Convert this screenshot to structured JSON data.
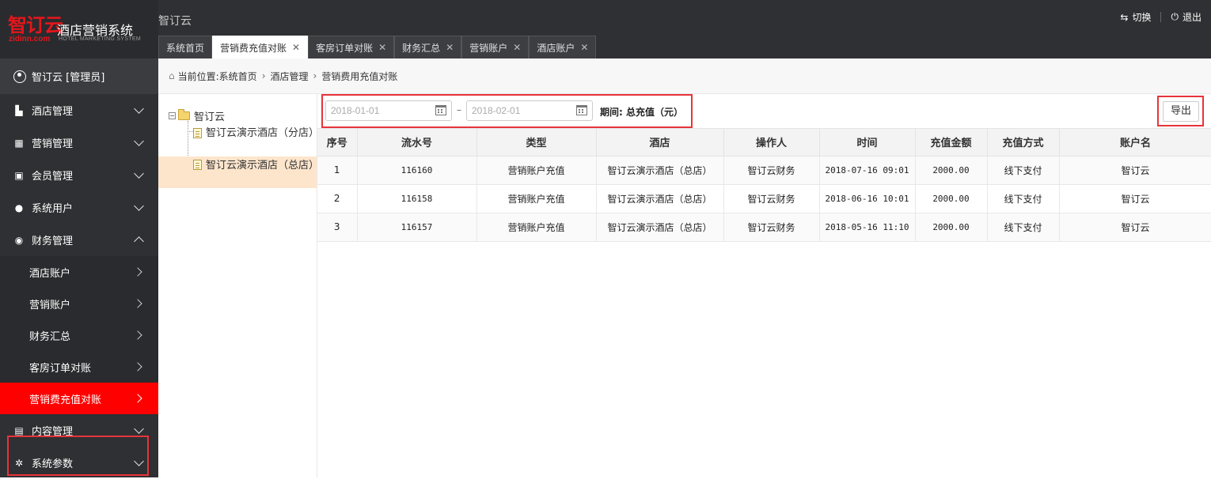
{
  "logo": {
    "mark": "智订云",
    "url": "zidinn.com",
    "name_cn": "酒店营销系统",
    "name_en": "HOTEL MARKETING SYSTEM"
  },
  "app_title": "智订云",
  "top_actions": {
    "switch": "切换",
    "logout": "退出"
  },
  "tabs": [
    {
      "label": "系统首页",
      "closable": false
    },
    {
      "label": "营销费充值对账",
      "closable": true,
      "active": true
    },
    {
      "label": "客房订单对账",
      "closable": true
    },
    {
      "label": "财务汇总",
      "closable": true
    },
    {
      "label": "营销账户",
      "closable": true
    },
    {
      "label": "酒店账户",
      "closable": true
    }
  ],
  "user": "智订云 [管理员]",
  "menu": [
    {
      "label": "酒店管理",
      "icon": "building-icon"
    },
    {
      "label": "营销管理",
      "icon": "grid-icon"
    },
    {
      "label": "会员管理",
      "icon": "id-card-icon"
    },
    {
      "label": "系统用户",
      "icon": "users-icon"
    },
    {
      "label": "财务管理",
      "icon": "money-icon",
      "expanded": true
    },
    {
      "label": "内容管理",
      "icon": "document-icon"
    },
    {
      "label": "系统参数",
      "icon": "gear-icon"
    }
  ],
  "finance_sub": [
    "酒店账户",
    "营销账户",
    "财务汇总",
    "客房订单对账",
    "营销费充值对账"
  ],
  "breadcrumb": {
    "prefix": "当前位置:",
    "items": [
      "系统首页",
      "酒店管理",
      "营销费用充值对账"
    ]
  },
  "tree": {
    "root": "智订云",
    "nodes": [
      "智订云演示酒店（分店）",
      "智订云演示酒店（总店）"
    ]
  },
  "filter": {
    "start_date": "2018-01-01",
    "end_date": "2018-02-01",
    "separator": "–",
    "period_label": "期间:",
    "period_value": "总充值（元）"
  },
  "export_label": "导出",
  "table": {
    "headers": [
      "序号",
      "流水号",
      "类型",
      "酒店",
      "操作人",
      "时间",
      "充值金额",
      "充值方式",
      "账户名"
    ],
    "rows": [
      [
        "1",
        "116160",
        "营销账户充值",
        "智订云演示酒店（总店）",
        "智订云财务",
        "2018-07-16 09:01",
        "2000.00",
        "线下支付",
        "智订云"
      ],
      [
        "2",
        "116158",
        "营销账户充值",
        "智订云演示酒店（总店）",
        "智订云财务",
        "2018-06-16 10:01",
        "2000.00",
        "线下支付",
        "智订云"
      ],
      [
        "3",
        "116157",
        "营销账户充值",
        "智订云演示酒店（总店）",
        "智订云财务",
        "2018-05-16 11:10",
        "2000.00",
        "线下支付",
        "智订云"
      ]
    ]
  },
  "colors": {
    "accent_red": "#ff0000",
    "highlight_box": "#e8333a",
    "sidebar_bg": "#2f3033"
  }
}
